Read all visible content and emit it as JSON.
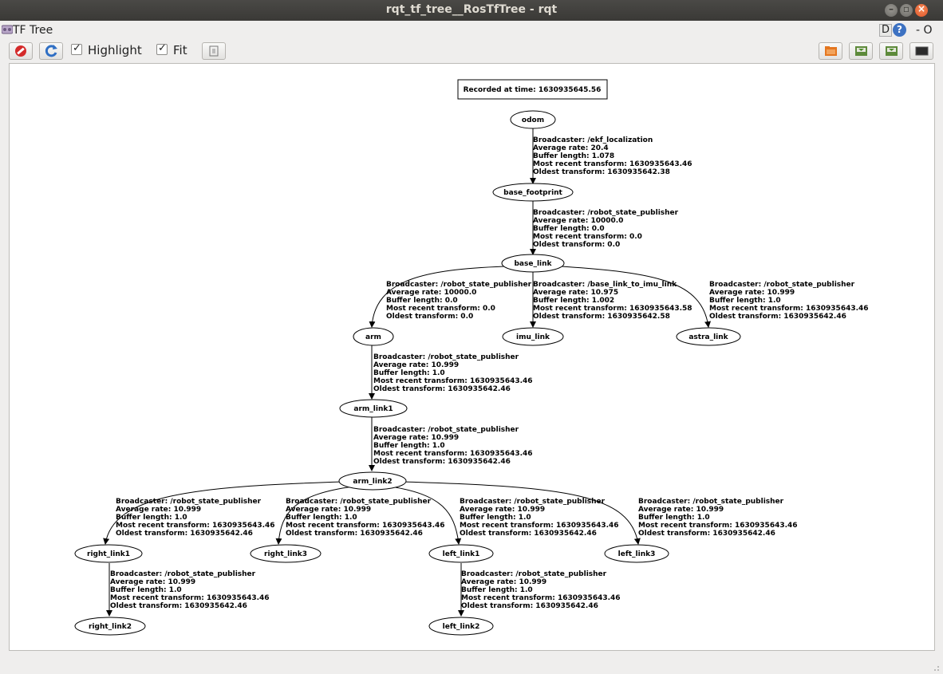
{
  "window": {
    "title": "rqt_tf_tree__RosTfTree - rqt",
    "min_glyph": "–",
    "max_glyph": "▫",
    "close_glyph": "×"
  },
  "plugin": {
    "title": "TF Tree",
    "icon": "tf-tree-icon",
    "d_label": "D",
    "help_glyph": "?",
    "minus_o": "- O"
  },
  "toolbar": {
    "highlight_label": "Highlight",
    "highlight_checked": true,
    "fit_label": "Fit",
    "fit_checked": true,
    "check_glyph": "✓",
    "buttons": [
      "clear-icon",
      "refresh-icon",
      "fit-view-icon",
      "open-icon",
      "save-dot-icon",
      "save-image-icon",
      "screenshot-icon"
    ]
  },
  "tree": {
    "recorded": "Recorded at time: 1630935645.56",
    "nodes": {
      "odom": "odom",
      "base_footprint": "base_footprint",
      "base_link": "base_link",
      "arm": "arm",
      "imu_link": "imu_link",
      "astra_link": "astra_link",
      "arm_link1": "arm_link1",
      "arm_link2": "arm_link2",
      "right_link1": "right_link1",
      "right_link3": "right_link3",
      "left_link1": "left_link1",
      "left_link3": "left_link3",
      "right_link2": "right_link2",
      "left_link2": "left_link2"
    },
    "edges": {
      "odom_base_footprint": [
        "Broadcaster: /ekf_localization",
        "Average rate: 20.4",
        "Buffer length: 1.078",
        "Most recent transform: 1630935643.46",
        "Oldest transform: 1630935642.38"
      ],
      "base_footprint_base_link": [
        "Broadcaster: /robot_state_publisher",
        "Average rate: 10000.0",
        "Buffer length: 0.0",
        "Most recent transform: 0.0",
        "Oldest transform: 0.0"
      ],
      "base_link_arm": [
        "Broadcaster: /robot_state_publisher",
        "Average rate: 10000.0",
        "Buffer length: 0.0",
        "Most recent transform: 0.0",
        "Oldest transform: 0.0"
      ],
      "base_link_imu_link": [
        "Broadcaster: /base_link_to_imu_link",
        "Average rate: 10.975",
        "Buffer length: 1.002",
        "Most recent transform: 1630935643.58",
        "Oldest transform: 1630935642.58"
      ],
      "base_link_astra_link": [
        "Broadcaster: /robot_state_publisher",
        "Average rate: 10.999",
        "Buffer length: 1.0",
        "Most recent transform: 1630935643.46",
        "Oldest transform: 1630935642.46"
      ],
      "arm_arm_link1": [
        "Broadcaster: /robot_state_publisher",
        "Average rate: 10.999",
        "Buffer length: 1.0",
        "Most recent transform: 1630935643.46",
        "Oldest transform: 1630935642.46"
      ],
      "arm_link1_arm_link2": [
        "Broadcaster: /robot_state_publisher",
        "Average rate: 10.999",
        "Buffer length: 1.0",
        "Most recent transform: 1630935643.46",
        "Oldest transform: 1630935642.46"
      ],
      "arm_link2_right_link1": [
        "Broadcaster: /robot_state_publisher",
        "Average rate: 10.999",
        "Buffer length: 1.0",
        "Most recent transform: 1630935643.46",
        "Oldest transform: 1630935642.46"
      ],
      "arm_link2_right_link3": [
        "Broadcaster: /robot_state_publisher",
        "Average rate: 10.999",
        "Buffer length: 1.0",
        "Most recent transform: 1630935643.46",
        "Oldest transform: 1630935642.46"
      ],
      "arm_link2_left_link1": [
        "Broadcaster: /robot_state_publisher",
        "Average rate: 10.999",
        "Buffer length: 1.0",
        "Most recent transform: 1630935643.46",
        "Oldest transform: 1630935642.46"
      ],
      "arm_link2_left_link3": [
        "Broadcaster: /robot_state_publisher",
        "Average rate: 10.999",
        "Buffer length: 1.0",
        "Most recent transform: 1630935643.46",
        "Oldest transform: 1630935642.46"
      ],
      "right_link1_right_link2": [
        "Broadcaster: /robot_state_publisher",
        "Average rate: 10.999",
        "Buffer length: 1.0",
        "Most recent transform: 1630935643.46",
        "Oldest transform: 1630935642.46"
      ],
      "left_link1_left_link2": [
        "Broadcaster: /robot_state_publisher",
        "Average rate: 10.999",
        "Buffer length: 1.0",
        "Most recent transform: 1630935643.46",
        "Oldest transform: 1630935642.46"
      ]
    }
  }
}
